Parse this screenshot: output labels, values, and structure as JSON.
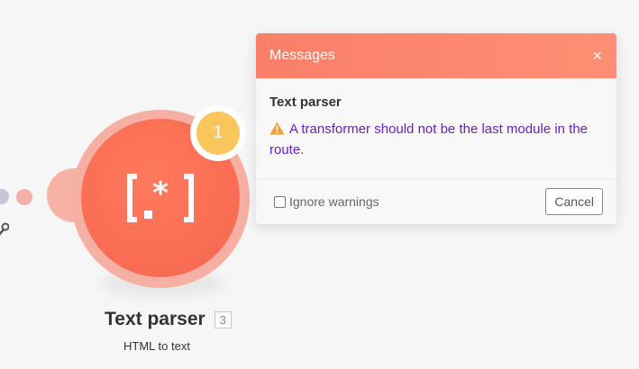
{
  "module": {
    "name": "Text parser",
    "number": "3",
    "subtitle": "HTML to text",
    "badge_count": "1",
    "icon": "regex-bracket-icon",
    "color": "#f86c53"
  },
  "popover": {
    "title": "Messages",
    "close_symbol": "×",
    "section_title": "Text parser",
    "warning_icon": "warning-triangle-icon",
    "message": "A transformer should not be the last module in the route.",
    "ignore_label": "Ignore warnings",
    "ignore_checked": false,
    "cancel_label": "Cancel",
    "header_color": "#fa7f68",
    "message_color": "#6b1fbf"
  }
}
